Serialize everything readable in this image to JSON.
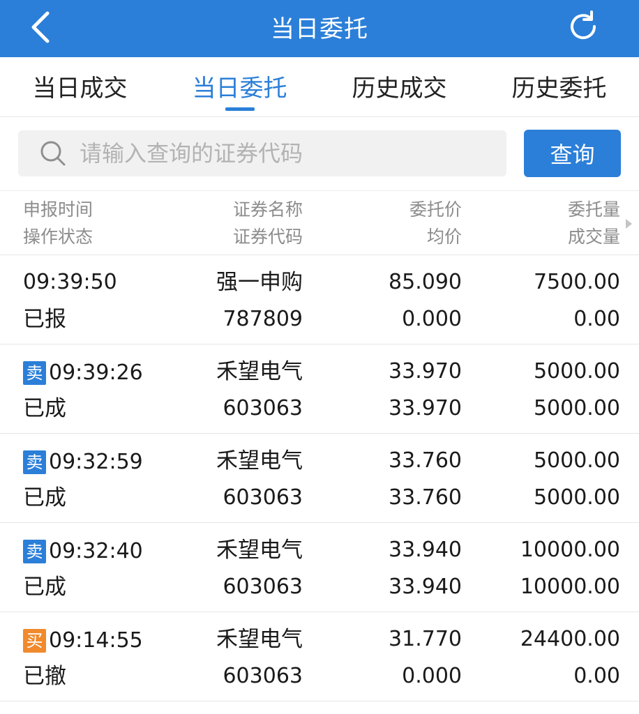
{
  "header": {
    "title": "当日委托",
    "back_icon": "chevron-left-icon",
    "refresh_icon": "refresh-icon",
    "color": "#2b7fd8"
  },
  "tabs": [
    {
      "label": "当日成交",
      "active": false
    },
    {
      "label": "当日委托",
      "active": true
    },
    {
      "label": "历史成交",
      "active": false
    },
    {
      "label": "历史委托",
      "active": false
    }
  ],
  "search": {
    "placeholder": "请输入查询的证券代码",
    "value": "",
    "button_label": "查询"
  },
  "table": {
    "columns": [
      {
        "line1": "申报时间",
        "line2": "操作状态"
      },
      {
        "line1": "证券名称",
        "line2": "证券代码"
      },
      {
        "line1": "委托价",
        "line2": "均价"
      },
      {
        "line1": "委托量",
        "line2": "成交量"
      }
    ],
    "rows": [
      {
        "side": "",
        "time": "09:39:50",
        "status": "已报",
        "name": "强一申购",
        "code": "787809",
        "price": "85.090",
        "avg_price": "0.000",
        "qty": "7500.00",
        "filled": "0.00"
      },
      {
        "side": "卖",
        "time": "09:39:26",
        "status": "已成",
        "name": "禾望电气",
        "code": "603063",
        "price": "33.970",
        "avg_price": "33.970",
        "qty": "5000.00",
        "filled": "5000.00"
      },
      {
        "side": "卖",
        "time": "09:32:59",
        "status": "已成",
        "name": "禾望电气",
        "code": "603063",
        "price": "33.760",
        "avg_price": "33.760",
        "qty": "5000.00",
        "filled": "5000.00"
      },
      {
        "side": "卖",
        "time": "09:32:40",
        "status": "已成",
        "name": "禾望电气",
        "code": "603063",
        "price": "33.940",
        "avg_price": "33.940",
        "qty": "10000.00",
        "filled": "10000.00"
      },
      {
        "side": "买",
        "time": "09:14:55",
        "status": "已撤",
        "name": "禾望电气",
        "code": "603063",
        "price": "31.770",
        "avg_price": "0.000",
        "qty": "24400.00",
        "filled": "0.00"
      }
    ]
  },
  "colors": {
    "sell_badge": "#2b7fd8",
    "buy_badge": "#f08a2c"
  }
}
